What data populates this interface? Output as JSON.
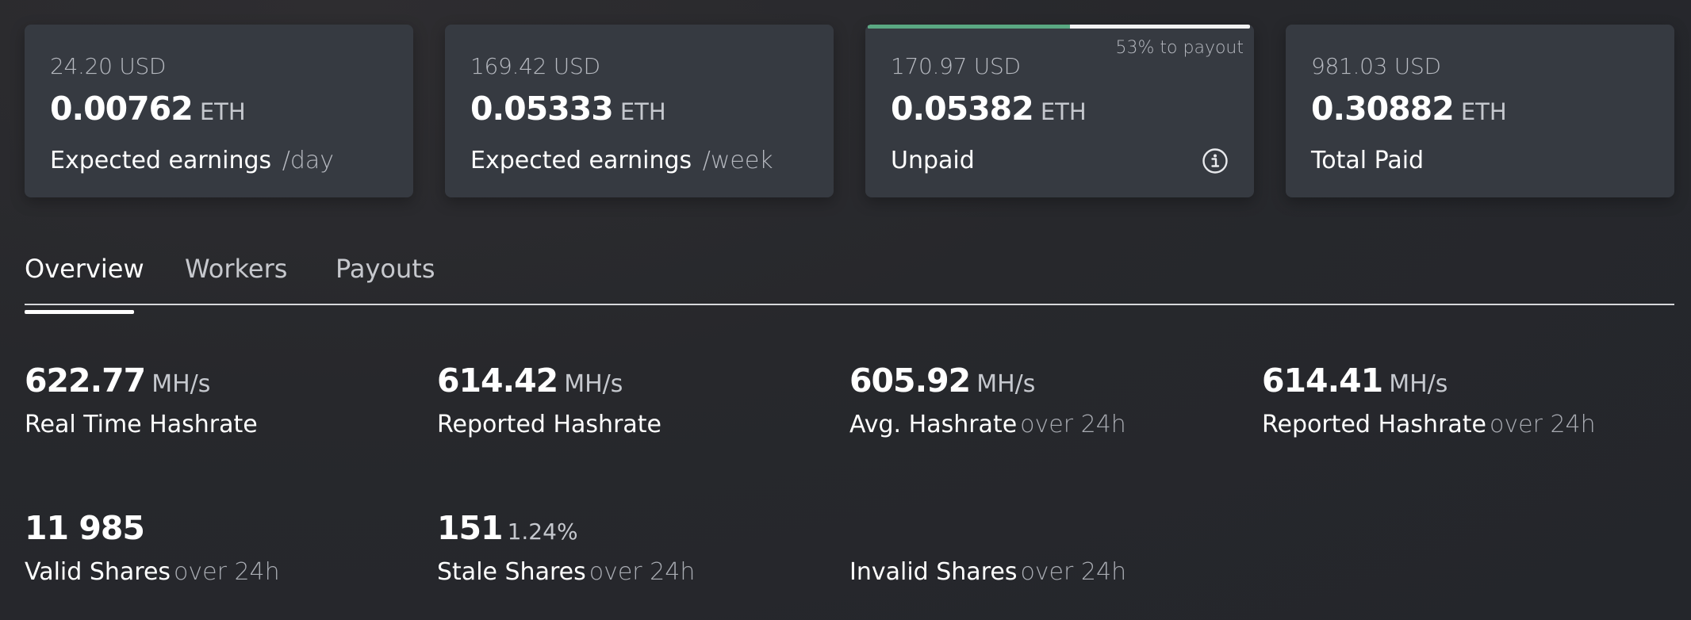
{
  "cards": [
    {
      "usd": "24.20 USD",
      "eth_value": "0.00762",
      "eth_unit": "ETH",
      "label": "Expected earnings",
      "suffix": "/day"
    },
    {
      "usd": "169.42 USD",
      "eth_value": "0.05333",
      "eth_unit": "ETH",
      "label": "Expected earnings",
      "suffix": "/week"
    },
    {
      "usd": "170.97 USD",
      "eth_value": "0.05382",
      "eth_unit": "ETH",
      "label": "Unpaid",
      "payout_progress_percent": 53,
      "payout_note": "53% to payout",
      "icon": "info-icon",
      "progress_color": "#5aa882"
    },
    {
      "usd": "981.03 USD",
      "eth_value": "0.30882",
      "eth_unit": "ETH",
      "label": "Total Paid"
    }
  ],
  "tabs": [
    {
      "label": "Overview",
      "active": true
    },
    {
      "label": "Workers",
      "active": false
    },
    {
      "label": "Payouts",
      "active": false
    }
  ],
  "stats": {
    "realtime": {
      "value": "622.77",
      "unit": "MH/s",
      "label": "Real Time Hashrate"
    },
    "reported": {
      "value": "614.42",
      "unit": "MH/s",
      "label": "Reported Hashrate"
    },
    "avg": {
      "value": "605.92",
      "unit": "MH/s",
      "label": "Avg. Hashrate",
      "suffix": "over 24h"
    },
    "reported24": {
      "value": "614.41",
      "unit": "MH/s",
      "label": "Reported Hashrate",
      "suffix": "over 24h"
    },
    "valid": {
      "value": "11 985",
      "label": "Valid Shares",
      "suffix": "over 24h"
    },
    "stale": {
      "value": "151",
      "percent": "1.24%",
      "label": "Stale Shares",
      "suffix": "over 24h"
    },
    "invalid": {
      "label": "Invalid Shares",
      "suffix": "over 24h"
    }
  },
  "colors": {
    "background": "#27282c",
    "card": "#363a41",
    "accent_green": "#5aa882"
  }
}
